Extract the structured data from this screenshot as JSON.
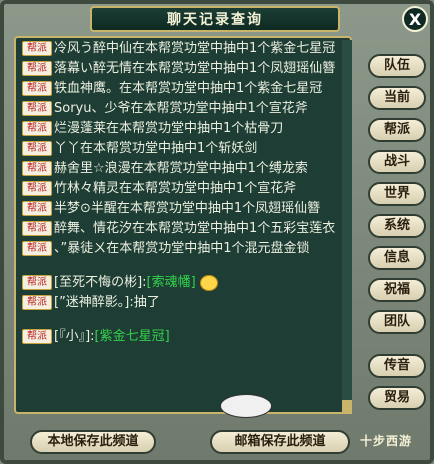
{
  "window": {
    "title": "聊天记录查询",
    "close_label": "X"
  },
  "chat": {
    "messages": [
      {
        "badge": "帮派",
        "text": "冷风う醉中仙在本帮赏功堂中抽中1个紫金七星冠"
      },
      {
        "badge": "帮派",
        "text": "落幕い醉无情在本帮赏功堂中抽中1个凤翅瑶仙簪"
      },
      {
        "badge": "帮派",
        "text": "铁血神鹰。在本帮赏功堂中抽中1个紫金七星冠"
      },
      {
        "badge": "帮派",
        "text": "Soryu、少爷在本帮赏功堂中抽中1个宣花斧"
      },
      {
        "badge": "帮派",
        "text": "烂漫蓬莱在本帮赏功堂中抽中1个枯骨刀"
      },
      {
        "badge": "帮派",
        "text": "丫丫在本帮赏功堂中抽中1个斩妖剑"
      },
      {
        "badge": "帮派",
        "text": "赫舍里☆浪漫在本帮赏功堂中抽中1个缚龙索"
      },
      {
        "badge": "帮派",
        "text": "竹林々精灵在本帮赏功堂中抽中1个宣花斧"
      },
      {
        "badge": "帮派",
        "text": "半梦⊙半醒在本帮赏功堂中抽中1个凤翅瑶仙簪"
      },
      {
        "badge": "帮派",
        "text": "醉舞、情花汐在本帮赏功堂中抽中1个五彩宝莲衣"
      },
      {
        "badge": "帮派",
        "text": "、”暴徒ㄨ在本帮赏功堂中抽中1个混元盘金锁"
      }
    ],
    "player_lines": [
      {
        "badge": "帮派",
        "speaker": "[至死不悔の彬]:",
        "green": "[索魂幡]"
      },
      {
        "badge": "帮派",
        "speaker": "[”迷神醉影。]:",
        "text": "抽了"
      },
      {
        "badge": "帮派",
        "speaker": "[『小』]:",
        "green": "[紫金七星冠]"
      }
    ]
  },
  "side_buttons": [
    {
      "label": "队伍"
    },
    {
      "label": "当前"
    },
    {
      "label": "帮派"
    },
    {
      "label": "战斗"
    },
    {
      "label": "世界"
    },
    {
      "label": "系统"
    },
    {
      "label": "信息"
    },
    {
      "label": "祝福"
    },
    {
      "label": "团队"
    },
    {
      "label": "传音"
    },
    {
      "label": "贸易"
    }
  ],
  "bottom_buttons": {
    "save_local": "本地保存此频道",
    "save_mail": "邮箱保存此频道"
  },
  "brand": "十步西游"
}
